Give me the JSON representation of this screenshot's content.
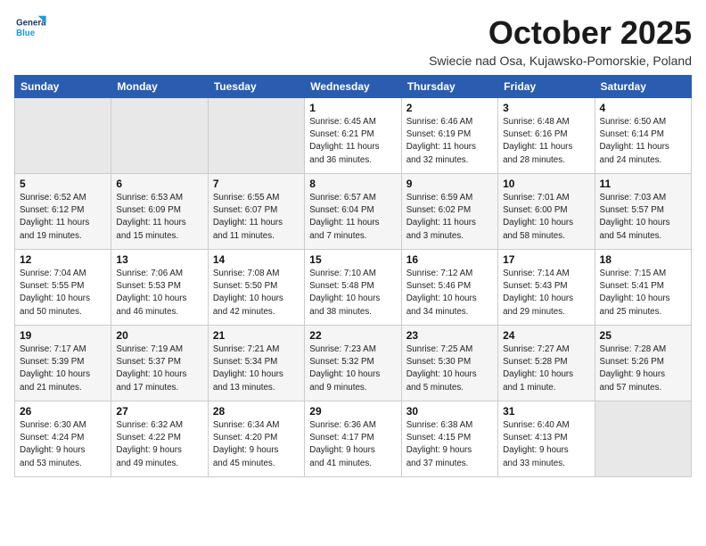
{
  "logo": {
    "line1": "General",
    "line2": "Blue"
  },
  "title": "October 2025",
  "subtitle": "Swiecie nad Osa, Kujawsko-Pomorskie, Poland",
  "days_of_week": [
    "Sunday",
    "Monday",
    "Tuesday",
    "Wednesday",
    "Thursday",
    "Friday",
    "Saturday"
  ],
  "weeks": [
    [
      {
        "day": "",
        "info": ""
      },
      {
        "day": "",
        "info": ""
      },
      {
        "day": "",
        "info": ""
      },
      {
        "day": "1",
        "info": "Sunrise: 6:45 AM\nSunset: 6:21 PM\nDaylight: 11 hours\nand 36 minutes."
      },
      {
        "day": "2",
        "info": "Sunrise: 6:46 AM\nSunset: 6:19 PM\nDaylight: 11 hours\nand 32 minutes."
      },
      {
        "day": "3",
        "info": "Sunrise: 6:48 AM\nSunset: 6:16 PM\nDaylight: 11 hours\nand 28 minutes."
      },
      {
        "day": "4",
        "info": "Sunrise: 6:50 AM\nSunset: 6:14 PM\nDaylight: 11 hours\nand 24 minutes."
      }
    ],
    [
      {
        "day": "5",
        "info": "Sunrise: 6:52 AM\nSunset: 6:12 PM\nDaylight: 11 hours\nand 19 minutes."
      },
      {
        "day": "6",
        "info": "Sunrise: 6:53 AM\nSunset: 6:09 PM\nDaylight: 11 hours\nand 15 minutes."
      },
      {
        "day": "7",
        "info": "Sunrise: 6:55 AM\nSunset: 6:07 PM\nDaylight: 11 hours\nand 11 minutes."
      },
      {
        "day": "8",
        "info": "Sunrise: 6:57 AM\nSunset: 6:04 PM\nDaylight: 11 hours\nand 7 minutes."
      },
      {
        "day": "9",
        "info": "Sunrise: 6:59 AM\nSunset: 6:02 PM\nDaylight: 11 hours\nand 3 minutes."
      },
      {
        "day": "10",
        "info": "Sunrise: 7:01 AM\nSunset: 6:00 PM\nDaylight: 10 hours\nand 58 minutes."
      },
      {
        "day": "11",
        "info": "Sunrise: 7:03 AM\nSunset: 5:57 PM\nDaylight: 10 hours\nand 54 minutes."
      }
    ],
    [
      {
        "day": "12",
        "info": "Sunrise: 7:04 AM\nSunset: 5:55 PM\nDaylight: 10 hours\nand 50 minutes."
      },
      {
        "day": "13",
        "info": "Sunrise: 7:06 AM\nSunset: 5:53 PM\nDaylight: 10 hours\nand 46 minutes."
      },
      {
        "day": "14",
        "info": "Sunrise: 7:08 AM\nSunset: 5:50 PM\nDaylight: 10 hours\nand 42 minutes."
      },
      {
        "day": "15",
        "info": "Sunrise: 7:10 AM\nSunset: 5:48 PM\nDaylight: 10 hours\nand 38 minutes."
      },
      {
        "day": "16",
        "info": "Sunrise: 7:12 AM\nSunset: 5:46 PM\nDaylight: 10 hours\nand 34 minutes."
      },
      {
        "day": "17",
        "info": "Sunrise: 7:14 AM\nSunset: 5:43 PM\nDaylight: 10 hours\nand 29 minutes."
      },
      {
        "day": "18",
        "info": "Sunrise: 7:15 AM\nSunset: 5:41 PM\nDaylight: 10 hours\nand 25 minutes."
      }
    ],
    [
      {
        "day": "19",
        "info": "Sunrise: 7:17 AM\nSunset: 5:39 PM\nDaylight: 10 hours\nand 21 minutes."
      },
      {
        "day": "20",
        "info": "Sunrise: 7:19 AM\nSunset: 5:37 PM\nDaylight: 10 hours\nand 17 minutes."
      },
      {
        "day": "21",
        "info": "Sunrise: 7:21 AM\nSunset: 5:34 PM\nDaylight: 10 hours\nand 13 minutes."
      },
      {
        "day": "22",
        "info": "Sunrise: 7:23 AM\nSunset: 5:32 PM\nDaylight: 10 hours\nand 9 minutes."
      },
      {
        "day": "23",
        "info": "Sunrise: 7:25 AM\nSunset: 5:30 PM\nDaylight: 10 hours\nand 5 minutes."
      },
      {
        "day": "24",
        "info": "Sunrise: 7:27 AM\nSunset: 5:28 PM\nDaylight: 10 hours\nand 1 minute."
      },
      {
        "day": "25",
        "info": "Sunrise: 7:28 AM\nSunset: 5:26 PM\nDaylight: 9 hours\nand 57 minutes."
      }
    ],
    [
      {
        "day": "26",
        "info": "Sunrise: 6:30 AM\nSunset: 4:24 PM\nDaylight: 9 hours\nand 53 minutes."
      },
      {
        "day": "27",
        "info": "Sunrise: 6:32 AM\nSunset: 4:22 PM\nDaylight: 9 hours\nand 49 minutes."
      },
      {
        "day": "28",
        "info": "Sunrise: 6:34 AM\nSunset: 4:20 PM\nDaylight: 9 hours\nand 45 minutes."
      },
      {
        "day": "29",
        "info": "Sunrise: 6:36 AM\nSunset: 4:17 PM\nDaylight: 9 hours\nand 41 minutes."
      },
      {
        "day": "30",
        "info": "Sunrise: 6:38 AM\nSunset: 4:15 PM\nDaylight: 9 hours\nand 37 minutes."
      },
      {
        "day": "31",
        "info": "Sunrise: 6:40 AM\nSunset: 4:13 PM\nDaylight: 9 hours\nand 33 minutes."
      },
      {
        "day": "",
        "info": ""
      }
    ]
  ]
}
